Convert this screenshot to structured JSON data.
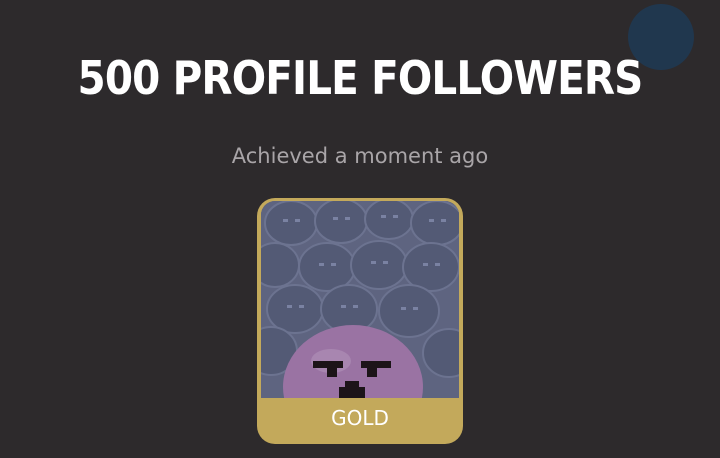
{
  "achievement": {
    "title": "500 PROFILE FOLLOWERS",
    "subtitle": "Achieved a moment ago",
    "tier_label": "GOLD",
    "art_icon": "grumpy-blob-crowd-icon"
  },
  "colors": {
    "background": "#2d2a2c",
    "title": "#ffffff",
    "subtitle": "#a9a5a8",
    "gold": "#c3a95b",
    "art_background": "#5e6480",
    "blob_purple": "#9a73a3"
  }
}
